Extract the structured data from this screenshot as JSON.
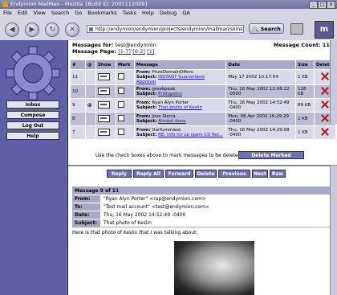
{
  "window": {
    "title": "Endymion MailMan - Mozilla {Build ID: 2001112009}"
  },
  "menu": [
    "File",
    "Edit",
    "View",
    "Search",
    "Go",
    "Bookmarks",
    "Tasks",
    "Help",
    "Debug",
    "QA"
  ],
  "nav": {
    "url": "http://endymion/endymion/projects/endymion/mailman/skins",
    "search_label": "Search"
  },
  "sidebar": {
    "buttons": [
      "Inbox",
      "Compose",
      "Log Out",
      "Help"
    ]
  },
  "header": {
    "messages_for_label": "Messages for:",
    "messages_for_value": "test@endymion",
    "count_label": "Message Count:",
    "count_value": "11",
    "page_label": "Message Page:",
    "page_current": "[1-7]",
    "page_next": "[6-2]",
    "page_other": "[1]"
  },
  "table": {
    "columns": [
      "#",
      "",
      "Show",
      "Mark",
      "Message",
      "Date",
      "Size",
      "Delete"
    ],
    "rows": [
      {
        "num": "11",
        "clip": "",
        "from": "PrizeDomainOffers",
        "subject": "INSTANT Guaranteed Approval",
        "date": "May 17 2002 10:17:54",
        "size": "1 KB"
      },
      {
        "num": "10",
        "clip": "",
        "from": "greekpeak",
        "subject": "Prislupelov",
        "date": "Thu, 16 May 2002 12:06:22 -0500",
        "size": "128 KB"
      },
      {
        "num": "9",
        "clip": "@",
        "from": "Ryan Alyn Porter",
        "subject": "That photo of Keslin",
        "date": "Thu, 16 May 2002 14:52:49 -0400",
        "size": "89 KB"
      },
      {
        "num": "8",
        "clip": "",
        "from": "Jose Sierra",
        "subject": "Almost done",
        "date": "Mon, 08 Apr 2002 16:29:29 -0400",
        "size": "1 KB"
      },
      {
        "num": "7",
        "clip": "",
        "from": "theYummiest",
        "subject": "RE: Info for Le spam CD Rel...",
        "date": "Thu, 16 May 2002 14:29:08 -0400",
        "size": "1 KB"
      }
    ],
    "from_label": "From:",
    "subject_label": "Subject:"
  },
  "bulk": {
    "hint": "Use the check boxes above to mark messages to be deleted.",
    "delete_marked": "Delete Marked"
  },
  "actions": [
    "Reply",
    "Reply All",
    "Forward",
    "Delete",
    "Previous",
    "Next",
    "Raw"
  ],
  "viewer": {
    "title": "Message 9 of 11",
    "fields": [
      {
        "label": "From:",
        "value": "\"Ryan Alyn Porter\" <rap@endymion.com>"
      },
      {
        "label": "To:",
        "value": "\"Test mail account\" <test@endymion.com>"
      },
      {
        "label": "Date:",
        "value": "Thu, 16 May 2002 14:52:49 -0400"
      },
      {
        "label": "Subject:",
        "value": "That photo of Keslin"
      }
    ],
    "body": "Here is that photo of Keslin that I was talking about:"
  }
}
